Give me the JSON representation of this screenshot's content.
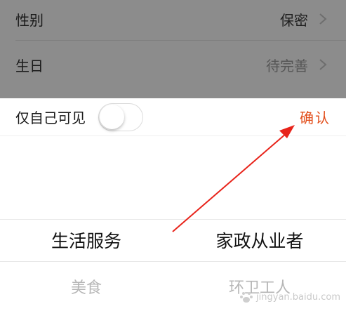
{
  "profile": {
    "rows": [
      {
        "label": "性别",
        "value": "保密"
      },
      {
        "label": "生日",
        "value": "待完善"
      }
    ]
  },
  "sheet": {
    "private_label": "仅自己可见",
    "private_toggle_on": false,
    "confirm_label": "确认",
    "accent_color": "#e24e1b",
    "picker": {
      "left_selected": "生活服务",
      "left_next": "美食",
      "right_selected": "家政从业者",
      "right_next": "环卫工人"
    }
  },
  "watermark": {
    "text": "jingyan.baidu.com"
  }
}
